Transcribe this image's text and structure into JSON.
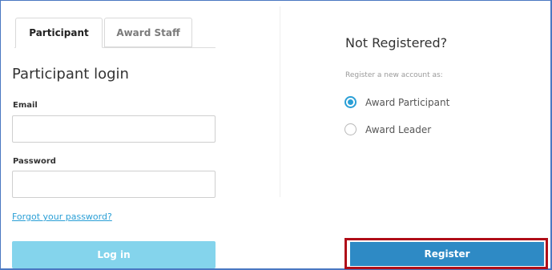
{
  "tabs": {
    "participant_label": "Participant",
    "award_staff_label": "Award Staff"
  },
  "login": {
    "title": "Participant login",
    "email_label": "Email",
    "email_value": "",
    "password_label": "Password",
    "password_value": "",
    "forgot_link": "Forgot your password?",
    "login_button": "Log in"
  },
  "register": {
    "title": "Not Registered?",
    "subtitle": "Register a new account as:",
    "options": [
      {
        "label": "Award Participant",
        "selected": true
      },
      {
        "label": "Award Leader",
        "selected": false
      }
    ],
    "register_button": "Register"
  },
  "colors": {
    "accent": "#2a9fd6",
    "login_button_bg": "#84d4ec",
    "register_button_bg": "#2e8ac5",
    "highlight_border": "#b00d18"
  }
}
